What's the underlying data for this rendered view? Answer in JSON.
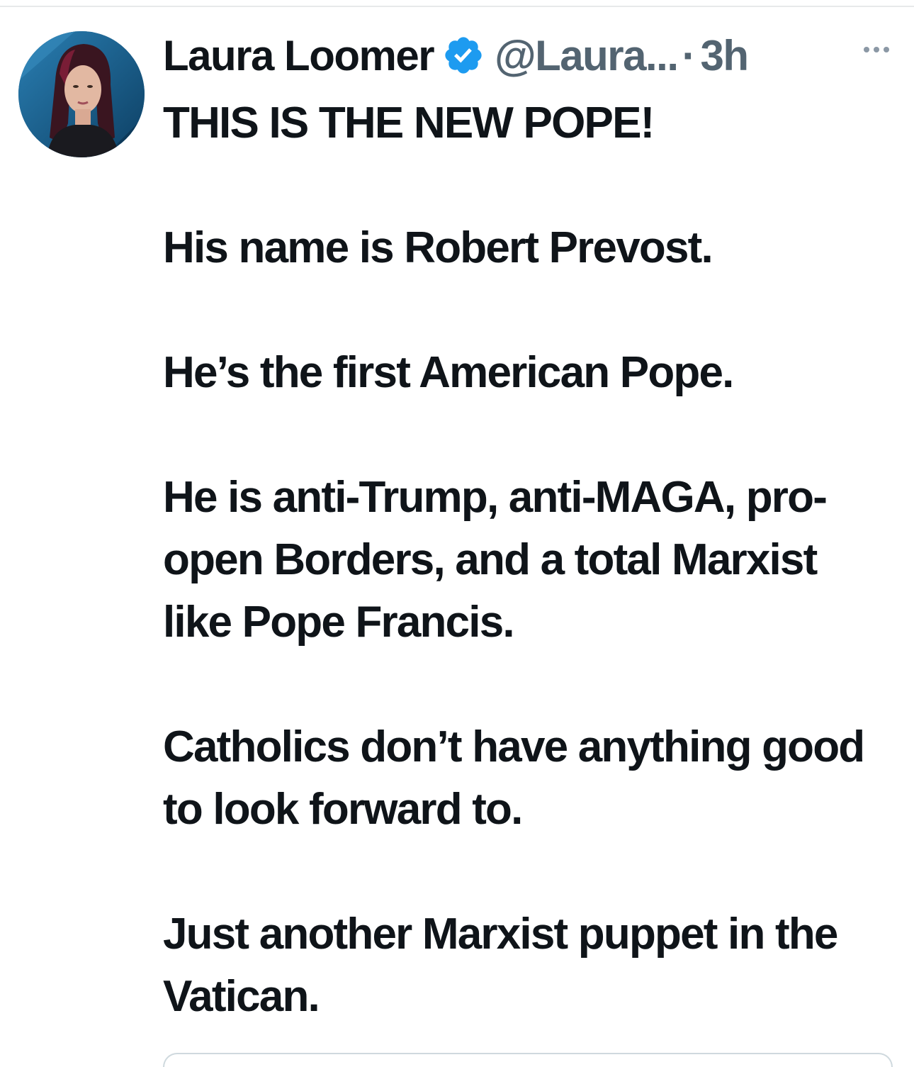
{
  "tweet": {
    "author": {
      "display_name": "Laura Loomer",
      "verified_icon": "verified-badge-icon",
      "handle": "@Laura...",
      "separator": "·",
      "time": "3h"
    },
    "more_icon": "more-options-icon",
    "paragraphs": [
      "THIS IS THE NEW POPE!",
      "His name is Robert Prevost.",
      "He’s the first American Pope.",
      "He is anti-Trump, anti-MAGA, pro-open Borders, and a total Marxist like Pope Francis.",
      "Catholics don’t have anything good to look forward to.",
      "Just another Marxist puppet in the Vatican."
    ]
  },
  "colors": {
    "text_primary": "#0f1419",
    "text_secondary": "#536471",
    "verified_blue": "#1d9bf0",
    "divider": "#e7e9ea"
  }
}
